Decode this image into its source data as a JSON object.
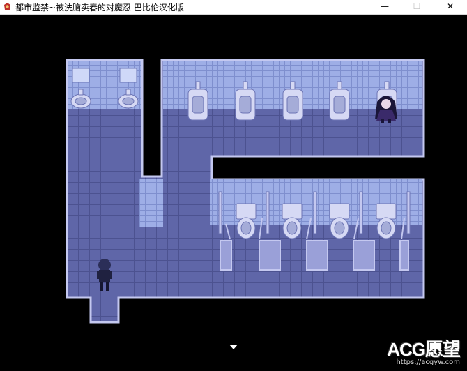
{
  "window": {
    "title": "都市监禁~被洗脑卖春的对魔忍 巴比伦汉化版",
    "minimize_label": "—",
    "maximize_label": "☐",
    "close_label": "✕",
    "app_icon": "game-app-icon"
  },
  "scene": {
    "location": "restroom",
    "colors": {
      "floor": "#5f66a8",
      "wall_tile": "#9eaee6",
      "border": "#c4c8f0",
      "void": "#000000"
    },
    "characters": [
      {
        "role": "player",
        "color": "#1f2140"
      },
      {
        "role": "npc-girl",
        "color": "#2a1f4a"
      }
    ]
  },
  "watermark": {
    "brand": "ACG愿望",
    "url": "https://acgyw.com"
  },
  "indicator": {
    "icon": "continue-arrow-icon"
  }
}
